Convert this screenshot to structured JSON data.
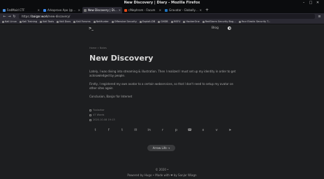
{
  "window": {
    "title": "New Discovery | Diary - Mozilla Firefox"
  },
  "tabs": [
    {
      "label": "FedMaid CTF",
      "color": "#4a8fe0",
      "active": false
    },
    {
      "label": "Arkoprovo Apo (@Kaym...",
      "color": "#3a88f0",
      "active": false
    },
    {
      "label": "New Discovery | Diary",
      "color": "#777777",
      "active": true
    },
    {
      "label": "r/Nephrom - Facum",
      "color": "#e64a19",
      "active": false
    },
    {
      "label": "Gravatar - Globally Reco...",
      "color": "#1e73be",
      "active": false
    }
  ],
  "navbar": {
    "url_prefix": "https://",
    "url_host": "baigar.work",
    "url_path": "/new-discovery/"
  },
  "bookmarks": [
    "Kali Linux",
    "Kali Training",
    "Kali Tools",
    "Kali Docs",
    "Kali Forums",
    "NetHunter",
    "Offensive Security",
    "Exploit-DB",
    "GHDB",
    "MSFU",
    "HackerOne",
    "RedStorm Security Bug...",
    "Your Elastic Security T..."
  ],
  "site": {
    "brand": ">_",
    "blog_link": "Blog"
  },
  "post": {
    "crumb": "Home » Notes",
    "title": "New Discovery",
    "para1": "Lately, I was diving into streaming & illustration. Then I realized I must set up my identity in order to get acknowledged by people.",
    "para2": "Firstly, I registered my own avatar to a certain webservices, so that I don't need to setup my avatar on other sites again",
    "para3": "Conclusion, Banjar for Internet",
    "meta_author": "Yuulazkar",
    "meta_reading": "47 Words",
    "meta_date": "2020-10-08 19:13"
  },
  "share_icons": [
    "twitter-icon",
    "facebook-icon",
    "tumblr-icon",
    "email-icon",
    "linkedin-icon",
    "reddit-icon",
    "pinterest-icon",
    "whatsapp-icon",
    "xing-icon",
    "vk-icon",
    "telegram-icon"
  ],
  "share_glyphs": [
    "t",
    "f",
    "t",
    "✉",
    "in",
    "r",
    "p",
    "☎",
    "x",
    "v",
    "➤"
  ],
  "next_post": {
    "label": "Arrow Life →"
  },
  "footer": {
    "line1": "© 2020 •",
    "line2": "Powered by Hugo • Made with ❤ by Sanjar Wiagn"
  }
}
